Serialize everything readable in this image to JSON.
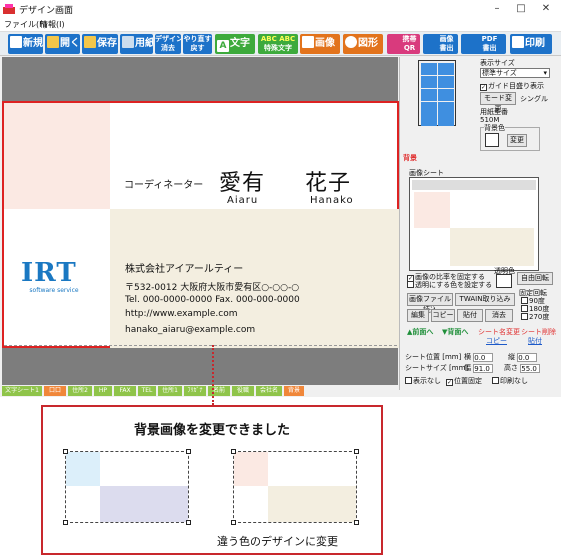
{
  "window": {
    "title": "デザイン画面",
    "controls": [
      "–",
      "□",
      "✕"
    ]
  },
  "menu": [
    "ファイル(F)",
    "情報(I)"
  ],
  "toolbar": {
    "new": "新規",
    "open": "開く",
    "save": "保存",
    "paper": "用紙",
    "design_erase_top": "デザイン",
    "design_erase_bottom": "消去",
    "undo_top": "やり直す",
    "undo_bottom": "戻す",
    "text": "文字",
    "special_top": "ABC ABC",
    "special_bottom": "特殊文字",
    "image": "画像",
    "shape": "図形",
    "qr_top": "携帯",
    "qr_bottom": "QR",
    "imgout_top": "画像",
    "imgout_bottom": "書出",
    "pdf_top": "PDF",
    "pdf_bottom": "書出",
    "print": "印刷",
    "colors": {
      "blue": "#1d72c9",
      "green": "#3daa3c",
      "orange": "#e2731c",
      "red": "#d9322e",
      "pink": "#d93a7d"
    }
  },
  "card": {
    "title": "コーディネーター",
    "name_family": "愛有",
    "name_given": "花子",
    "romaji_family": "Aiaru",
    "romaji_given": "Hanako",
    "logo_text": "IRT",
    "logo_sub": "software service",
    "company": "株式会社アイアールティー",
    "address": "〒532-0012  大阪府大阪市愛有区○-○○-○",
    "tel_fax": "Tel. 000-0000-0000  Fax. 000-000-0000",
    "url": "http://www.example.com",
    "email": "hanako_aiaru@example.com"
  },
  "panel": {
    "display_size_label": "表示サイズ",
    "display_size_value": "標準サイズ",
    "guide_toggle": "ガイド目盛り表示",
    "mode_change": "モード変更",
    "mode_value": "シングル",
    "paper_model_label": "用紙型番",
    "paper_model_value": "510M",
    "bg_color_label": "背景色",
    "change_btn": "変更",
    "section_bg": "背景",
    "sheet_label": "画像シート",
    "fix_ratio": "画像の比率を固定する",
    "transparent_color": "透明にする色を設定する",
    "transparency_label": "透明色",
    "free_rotate": "自由回転",
    "fixed_rotate": "固定回転",
    "load_file": "画像ファイル読込",
    "twain": "TWAIN取り込み",
    "rot90": "90度",
    "rot180": "180度",
    "rot270": "270度",
    "edit": "編集",
    "copy": "コピー",
    "paste": "貼付",
    "delete": "消去",
    "front": "▲前面へ",
    "back": "▼背面へ",
    "sheet_rename": "シート名変更",
    "sheet_delete": "シート削除",
    "copy_link": "コピー",
    "paste_link": "貼付",
    "sheet_pos": "シート位置 [mm]",
    "sheet_size": "シートサイズ [mm]",
    "w_label": "横",
    "h_label": "縦",
    "width_label": "幅",
    "height_label": "高さ",
    "w_val": "0.0",
    "h_val": "0.0",
    "width_val": "91.0",
    "height_val": "55.0",
    "hide": "表示なし",
    "lock_pos": "位置固定",
    "no_print": "印刷なし"
  },
  "tabs": [
    "文字シート1",
    "口口",
    "住所2",
    "HP",
    "FAX",
    "TEL",
    "住所1",
    "ﾌﾘｶﾞﾅ",
    "名前",
    "役職",
    "会社名",
    "背景"
  ],
  "callout": {
    "message": "背景画像を変更できました",
    "caption": "違う色のデザインに変更",
    "border_color": "#c8282d"
  }
}
